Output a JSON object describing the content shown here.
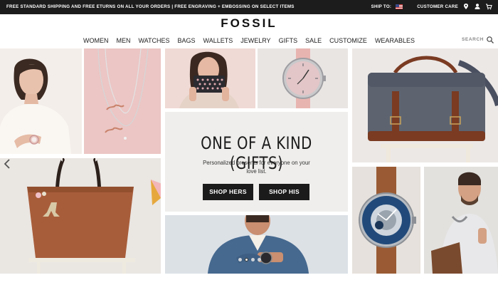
{
  "topbar": {
    "promo": "FREE STANDARD SHIPPING AND FREE ETURNS ON ALL YOUR ORDERS  |  FREE ENGRAVING + EMBOSSING ON SELECT ITEMS",
    "ship_to": "SHIP TO:",
    "customer_care": "CUSTOMER CARE"
  },
  "header": {
    "logo": "FOSSIL",
    "nav": [
      "WOMEN",
      "MEN",
      "WATCHES",
      "BAGS",
      "WALLETS",
      "JEWELRY",
      "GIFTS",
      "SALE",
      "CUSTOMIZE",
      "WEARABLES"
    ],
    "search_label": "SEARCH"
  },
  "hero": {
    "title": "ONE OF A KIND (GIFTS)",
    "subtitle": "Personalized presents for everyone on your love list.",
    "btn_hers": "SHOP HERS",
    "btn_his": "SHOP HIS"
  },
  "icons": [
    "us-flag-icon",
    "location-pin-icon",
    "user-icon",
    "cart-icon",
    "search-icon",
    "chevron-left-icon"
  ],
  "carousel": {
    "total": 4,
    "active": 1
  },
  "colors": {
    "topbar": "#1c1c1c",
    "button": "#1b1b1b",
    "tan_leather": "#a85d3a",
    "canvas_gray": "#5d6470"
  }
}
